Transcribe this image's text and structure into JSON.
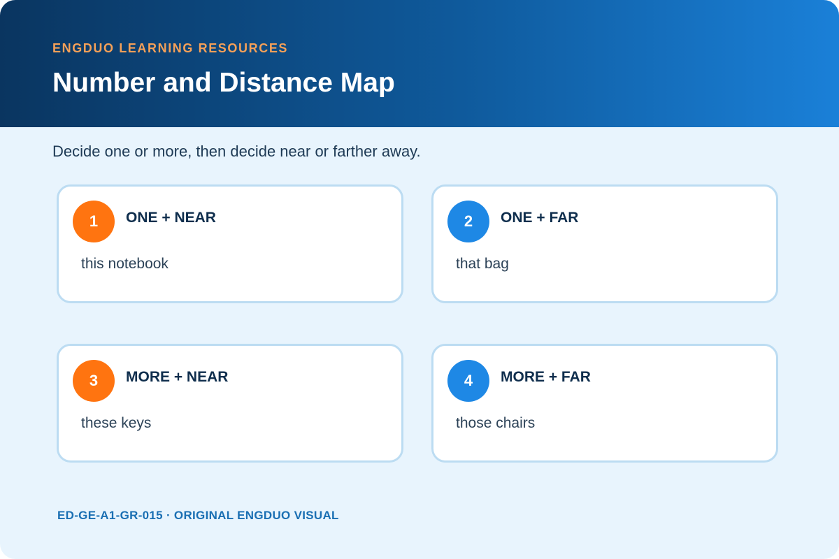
{
  "header": {
    "eyebrow": "ENGDUO LEARNING RESOURCES",
    "title": "Number and Distance Map"
  },
  "instruction": "Decide one or more, then decide near or farther away.",
  "cards": [
    {
      "number": "1",
      "label": "ONE + NEAR",
      "example": "this notebook",
      "badge_color": "#ff7410"
    },
    {
      "number": "2",
      "label": "ONE + FAR",
      "example": "that bag",
      "badge_color": "#1e88e5"
    },
    {
      "number": "3",
      "label": "MORE + NEAR",
      "example": "these keys",
      "badge_color": "#ff7410"
    },
    {
      "number": "4",
      "label": "MORE + FAR",
      "example": "those chairs",
      "badge_color": "#1e88e5"
    }
  ],
  "footer": "ED-GE-A1-GR-015 · ORIGINAL ENGDUO VISUAL",
  "colors": {
    "header_gradient_start": "#0a3560",
    "header_gradient_end": "#1a80d8",
    "eyebrow": "#f5a058",
    "background": "#e8f4fd",
    "card_border": "#bcdcf2",
    "near_accent": "#ff7410",
    "far_accent": "#1e88e5"
  }
}
